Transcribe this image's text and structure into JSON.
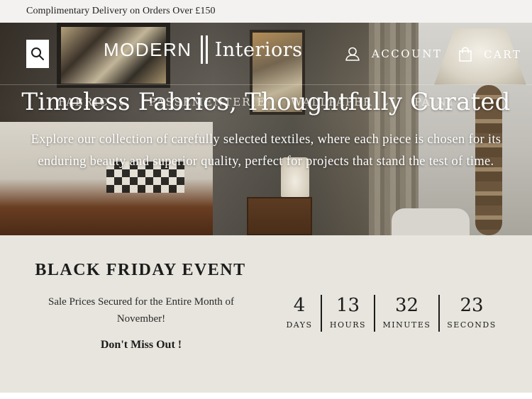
{
  "announcement": {
    "text": "Complimentary Delivery on Orders Over £150"
  },
  "header": {
    "logo": {
      "modern": "MODERN",
      "interiors": "Interiors"
    },
    "account_label": "ACCOUNT",
    "cart_label": "CART",
    "search_icon": "search-icon",
    "account_icon": "user-icon",
    "cart_icon": "shopping-bag-icon"
  },
  "nav": {
    "items": [
      {
        "label": "FABRIC",
        "has_dropdown": true
      },
      {
        "label": "PASSEMENTERIE",
        "has_dropdown": false
      },
      {
        "label": "WALLPAPER",
        "has_dropdown": true
      },
      {
        "label": "PAINT",
        "has_dropdown": false
      }
    ]
  },
  "hero": {
    "title": "Timeless Fabrics, Thoughtfully Curated",
    "subtitle": "Explore our collection of carefully selected textiles, where each piece is chosen for its enduring beauty and superior quality, perfect for projects that stand the test of time."
  },
  "promo": {
    "title": "BLACK FRIDAY EVENT",
    "text": "Sale Prices Secured for the Entire Month of November!",
    "cta": "Don't Miss Out !",
    "background": "#e7e5dd",
    "countdown": [
      {
        "value": "4",
        "label": "DAYS"
      },
      {
        "value": "13",
        "label": "HOURS"
      },
      {
        "value": "32",
        "label": "MINUTES"
      },
      {
        "value": "23",
        "label": "SECONDS"
      }
    ]
  }
}
